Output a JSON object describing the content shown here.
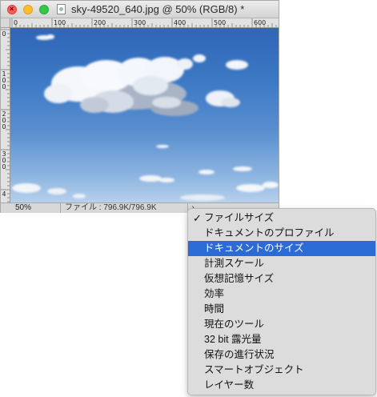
{
  "window": {
    "title": "sky-49520_640.jpg @ 50% (RGB/8) *"
  },
  "ruler": {
    "top_labels": [
      "0",
      "100",
      "200",
      "300",
      "400",
      "500",
      "600"
    ],
    "left_labels": [
      "0",
      "1\n0\n0",
      "2\n0\n0",
      "3\n0\n0",
      "4"
    ]
  },
  "statusbar": {
    "zoom": "50%",
    "file_info": "ファイル : 796.9K/796.9K",
    "arrow": "›"
  },
  "menu": {
    "items": [
      {
        "label": "ファイルサイズ",
        "checked": true
      },
      {
        "label": "ドキュメントのプロファイル",
        "checked": false
      },
      {
        "label": "ドキュメントのサイズ",
        "checked": false,
        "highlighted": true
      },
      {
        "label": "計測スケール",
        "checked": false
      },
      {
        "label": "仮想記憶サイズ",
        "checked": false
      },
      {
        "label": "効率",
        "checked": false
      },
      {
        "label": "時間",
        "checked": false
      },
      {
        "label": "現在のツール",
        "checked": false
      },
      {
        "label": "32 bit 露光量",
        "checked": false
      },
      {
        "label": "保存の進行状況",
        "checked": false
      },
      {
        "label": "スマートオブジェクト",
        "checked": false
      },
      {
        "label": "レイヤー数",
        "checked": false
      }
    ],
    "check_glyph": "✓"
  },
  "colors": {
    "menu_highlight": "#2b6bd6",
    "sky_top": "#2f66b6",
    "sky_bottom": "#b7d0ec"
  }
}
